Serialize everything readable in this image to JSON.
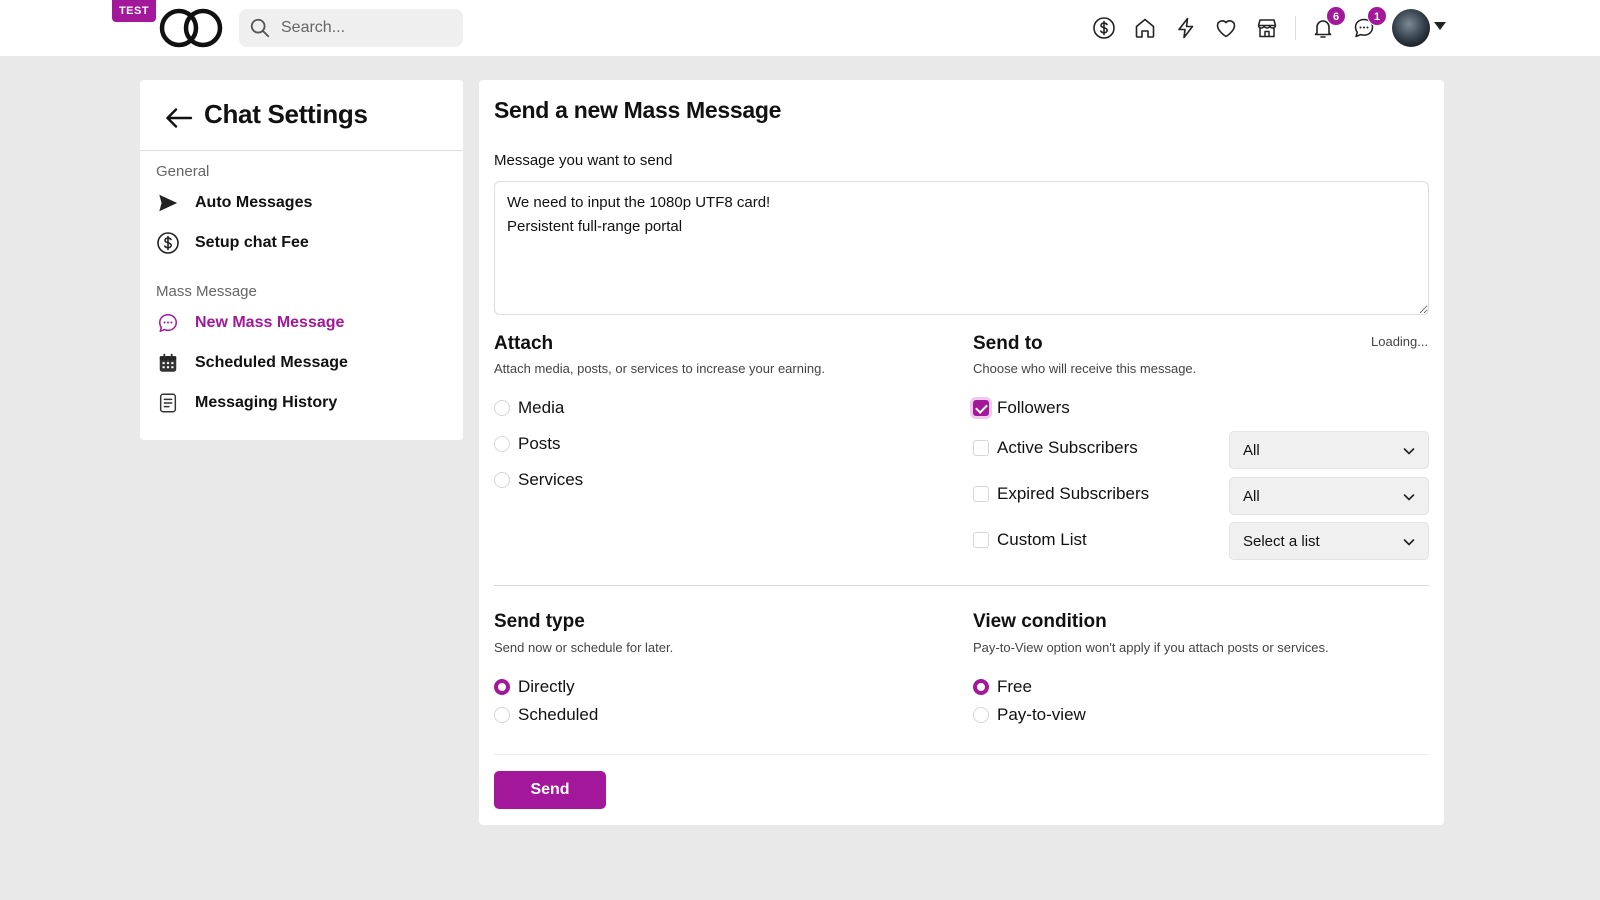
{
  "header": {
    "env_badge": "TEST",
    "logo_icon": "double-ring-logo",
    "search": {
      "placeholder": "Search..."
    },
    "nav_icons": [
      "dollar-icon",
      "home-icon",
      "lightning-icon",
      "heart-icon",
      "store-icon",
      "bell-icon",
      "chat-icon"
    ],
    "notifications_count": "6",
    "messages_count": "1",
    "accent_color": "#a3179a"
  },
  "sidebar": {
    "title": "Chat Settings",
    "sections": [
      {
        "label": "General",
        "items": [
          {
            "label": "Auto Messages",
            "icon": "send-icon"
          },
          {
            "label": "Setup chat Fee",
            "icon": "dollar-icon"
          }
        ]
      },
      {
        "label": "Mass Message",
        "items": [
          {
            "label": "New Mass Message",
            "icon": "chat-bubble-icon",
            "active": true
          },
          {
            "label": "Scheduled Message",
            "icon": "calendar-icon"
          },
          {
            "label": "Messaging History",
            "icon": "document-icon"
          }
        ]
      }
    ]
  },
  "main": {
    "title": "Send a new Mass Message",
    "message_label": "Message you want to send",
    "message_value": "We need to input the 1080p UTF8 card!\nPersistent full-range portal",
    "attach": {
      "title": "Attach",
      "subtitle": "Attach media, posts, or services to increase your earning.",
      "options": [
        {
          "label": "Media",
          "selected": false
        },
        {
          "label": "Posts",
          "selected": false
        },
        {
          "label": "Services",
          "selected": false
        }
      ]
    },
    "send_to": {
      "title": "Send to",
      "subtitle": "Choose who will receive this message.",
      "status": "Loading...",
      "options": [
        {
          "label": "Followers",
          "checked": true
        },
        {
          "label": "Active Subscribers",
          "checked": false,
          "select_value": "All"
        },
        {
          "label": "Expired Subscribers",
          "checked": false,
          "select_value": "All"
        },
        {
          "label": "Custom List",
          "checked": false,
          "select_value": "Select a list"
        }
      ]
    },
    "send_type": {
      "title": "Send type",
      "subtitle": "Send now or schedule for later.",
      "options": [
        {
          "label": "Directly",
          "selected": true
        },
        {
          "label": "Scheduled",
          "selected": false
        }
      ]
    },
    "view_condition": {
      "title": "View condition",
      "subtitle": "Pay-to-View option won't apply if you attach posts or services.",
      "options": [
        {
          "label": "Free",
          "selected": true
        },
        {
          "label": "Pay-to-view",
          "selected": false
        }
      ]
    },
    "send_button": "Send"
  }
}
